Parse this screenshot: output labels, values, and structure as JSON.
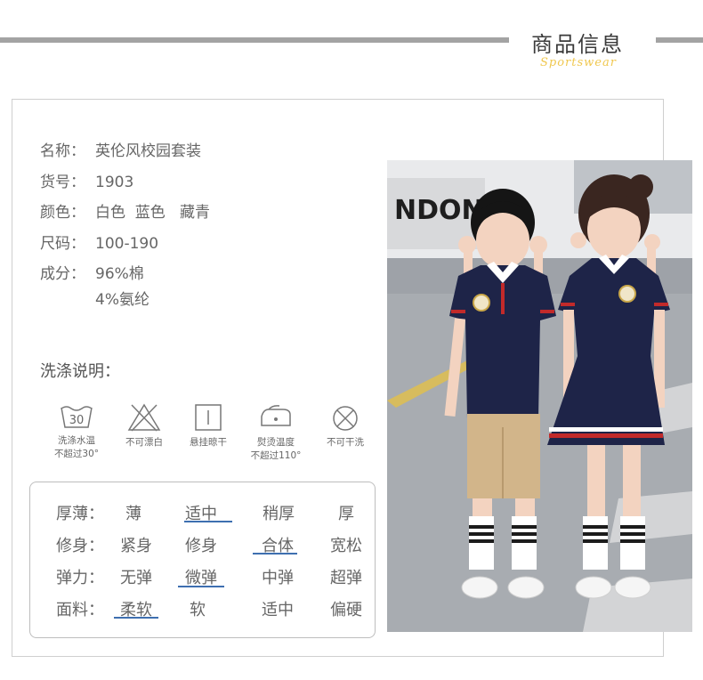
{
  "header": {
    "title": "商品信息",
    "subtitle": "Sportswear"
  },
  "specs": [
    {
      "label": "名称：",
      "value": "英伦风校园套装"
    },
    {
      "label": "货号：",
      "value": "1903"
    },
    {
      "label": "颜色：",
      "value": "白色  蓝色   藏青"
    },
    {
      "label": "尺码：",
      "value": "100-190"
    },
    {
      "label": "成分：",
      "value": "96%棉",
      "value2": "4%氨纶"
    }
  ],
  "washing": {
    "title": "洗涤说明：",
    "items": [
      {
        "icon": "wash-30-icon",
        "number": "30",
        "line1": "洗涤水温",
        "line2": "不超过30°"
      },
      {
        "icon": "no-bleach-icon",
        "line1": "不可漂白",
        "line2": ""
      },
      {
        "icon": "hang-dry-icon",
        "line1": "悬挂晾干",
        "line2": ""
      },
      {
        "icon": "iron-icon",
        "line1": "熨烫温度",
        "line2": "不超过110°"
      },
      {
        "icon": "no-dry-clean-icon",
        "line1": "不可干洗",
        "line2": ""
      }
    ]
  },
  "fit": {
    "rows": [
      {
        "label": "厚薄：",
        "options": [
          "薄",
          "适中",
          "稍厚",
          "厚"
        ],
        "selected": "适中"
      },
      {
        "label": "修身：",
        "options": [
          "紧身",
          "修身",
          "合体",
          "宽松"
        ],
        "selected": "合体"
      },
      {
        "label": "弹力：",
        "options": [
          "无弹",
          "微弹",
          "中弹",
          "超弹"
        ],
        "selected": "微弹"
      },
      {
        "label": "面料：",
        "options": [
          "柔软",
          "软",
          "适中",
          "偏硬"
        ],
        "selected": "柔软"
      }
    ],
    "underline_color": "#3e6fb0"
  },
  "photo": {
    "sign_text": "NDONE",
    "boy_shirt_color": "#1e2448",
    "boy_shorts_color": "#d2b58a",
    "dress_color": "#1e2448"
  }
}
